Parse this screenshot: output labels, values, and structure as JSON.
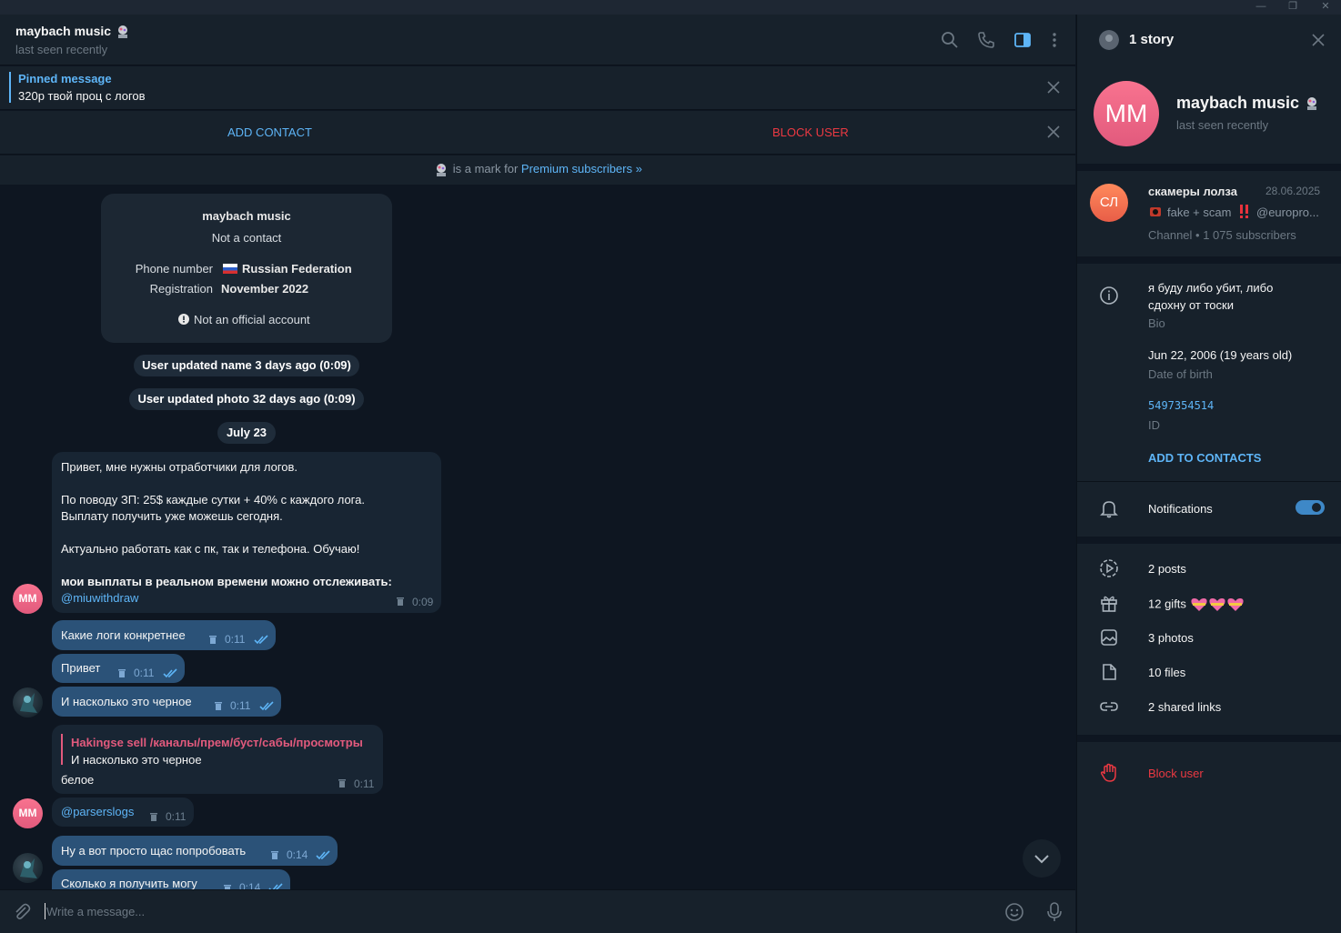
{
  "window": {
    "min_glyph": "—",
    "max_glyph": "❐",
    "close_glyph": "✕"
  },
  "chat_header": {
    "name": "maybach music",
    "status": "last seen recently"
  },
  "pinned": {
    "title": "Pinned message",
    "text": "320р твой проц с логов"
  },
  "actions": {
    "add_contact": "ADD CONTACT",
    "block_user": "BLOCK USER"
  },
  "premium_bar": {
    "text": "is a mark for",
    "link": "Premium subscribers »"
  },
  "info_card": {
    "name": "maybach music",
    "subtitle": "Not a contact",
    "phone_label": "Phone number",
    "phone_value": "Russian Federation",
    "reg_label": "Registration",
    "reg_value": "November 2022",
    "official": "Not an official account"
  },
  "services": {
    "name_update": "User updated name 3 days ago (0:09)",
    "photo_update": "User updated photo 32 days ago (0:09)",
    "date": "July 23"
  },
  "messages": {
    "m1_line1": "Привет, мне нужны отработчики для логов.",
    "m1_line2": "По поводу ЗП: 25$ каждые сутки + 40% с каждого лога.",
    "m1_line3": "Выплату получить уже можешь сегодня.",
    "m1_line4": "Актуально работать как с пк, так и телефона. Обучаю!",
    "m1_line5": "мои выплаты в реальном времени можно отслеживать:",
    "m1_link": "@miuwithdraw",
    "m1_time": "0:09",
    "m2": "Какие логи конкретнее",
    "m2_time": "0:11",
    "m3": "Привет",
    "m3_time": "0:11",
    "m4": "И насколько это черное",
    "m4_time": "0:11",
    "m5_reply_name": "Hakingse sell /каналы/прем/буст/сабы/просмотры",
    "m5_reply_text": "И насколько это черное",
    "m5": "белое",
    "m5_time": "0:11",
    "m6": "@parserslogs",
    "m6_time": "0:11",
    "m7": "Ну а вот просто щас попробовать",
    "m7_time": "0:14",
    "m8": "Сколько я получить могу",
    "m8_time": "0:14"
  },
  "avatar_initials": "MM",
  "composer": {
    "placeholder": "Write a message..."
  },
  "side": {
    "story": "1 story",
    "name": "maybach music",
    "status": "last seen recently",
    "avatar_initials": "MM",
    "channel": {
      "initials": "СЛ",
      "name": "скамеры лолза",
      "date": "28.06.2025",
      "preview": "fake + scam",
      "handle": "@europro...",
      "meta": "Channel • 1 075 subscribers"
    },
    "bio": "я буду либо убит, либо сдохну от тоски",
    "bio_label": "Bio",
    "birth": "Jun 22, 2006 (19 years old)",
    "birth_label": "Date of birth",
    "id": "5497354514",
    "id_label": "ID",
    "add_to_contacts": "ADD TO CONTACTS",
    "notifications": "Notifications",
    "notifications_on": true,
    "posts": "2 posts",
    "gifts": "12 gifts",
    "photos": "3 photos",
    "files": "10 files",
    "links": "2 shared links",
    "block": "Block user"
  },
  "colors": {
    "accent": "#5eb5f7",
    "danger": "#ec3942",
    "outgoing": "#2b5278",
    "incoming": "#182533"
  }
}
